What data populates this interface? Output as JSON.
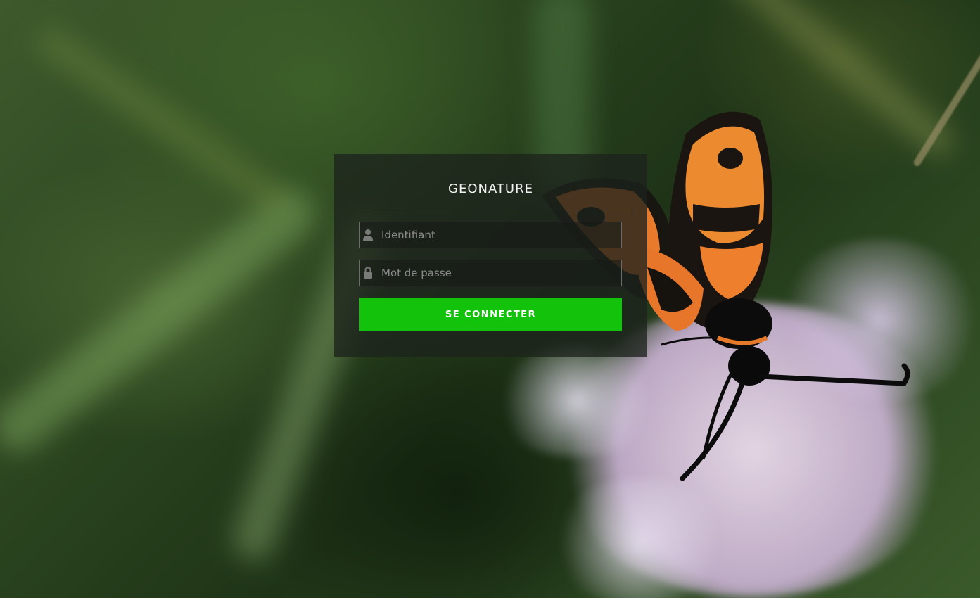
{
  "app": {
    "title": "GEONATURE"
  },
  "login": {
    "username_placeholder": "Identifiant",
    "username_value": "",
    "password_placeholder": "Mot de passe",
    "password_value": "",
    "submit_label": "SE CONNECTER"
  },
  "icons": {
    "username": "user-icon",
    "password": "lock-icon"
  },
  "colors": {
    "accent": "#13c20b",
    "title_rule": "#2ec431",
    "panel_bg": "rgba(28, 34, 28, 0.78)"
  }
}
